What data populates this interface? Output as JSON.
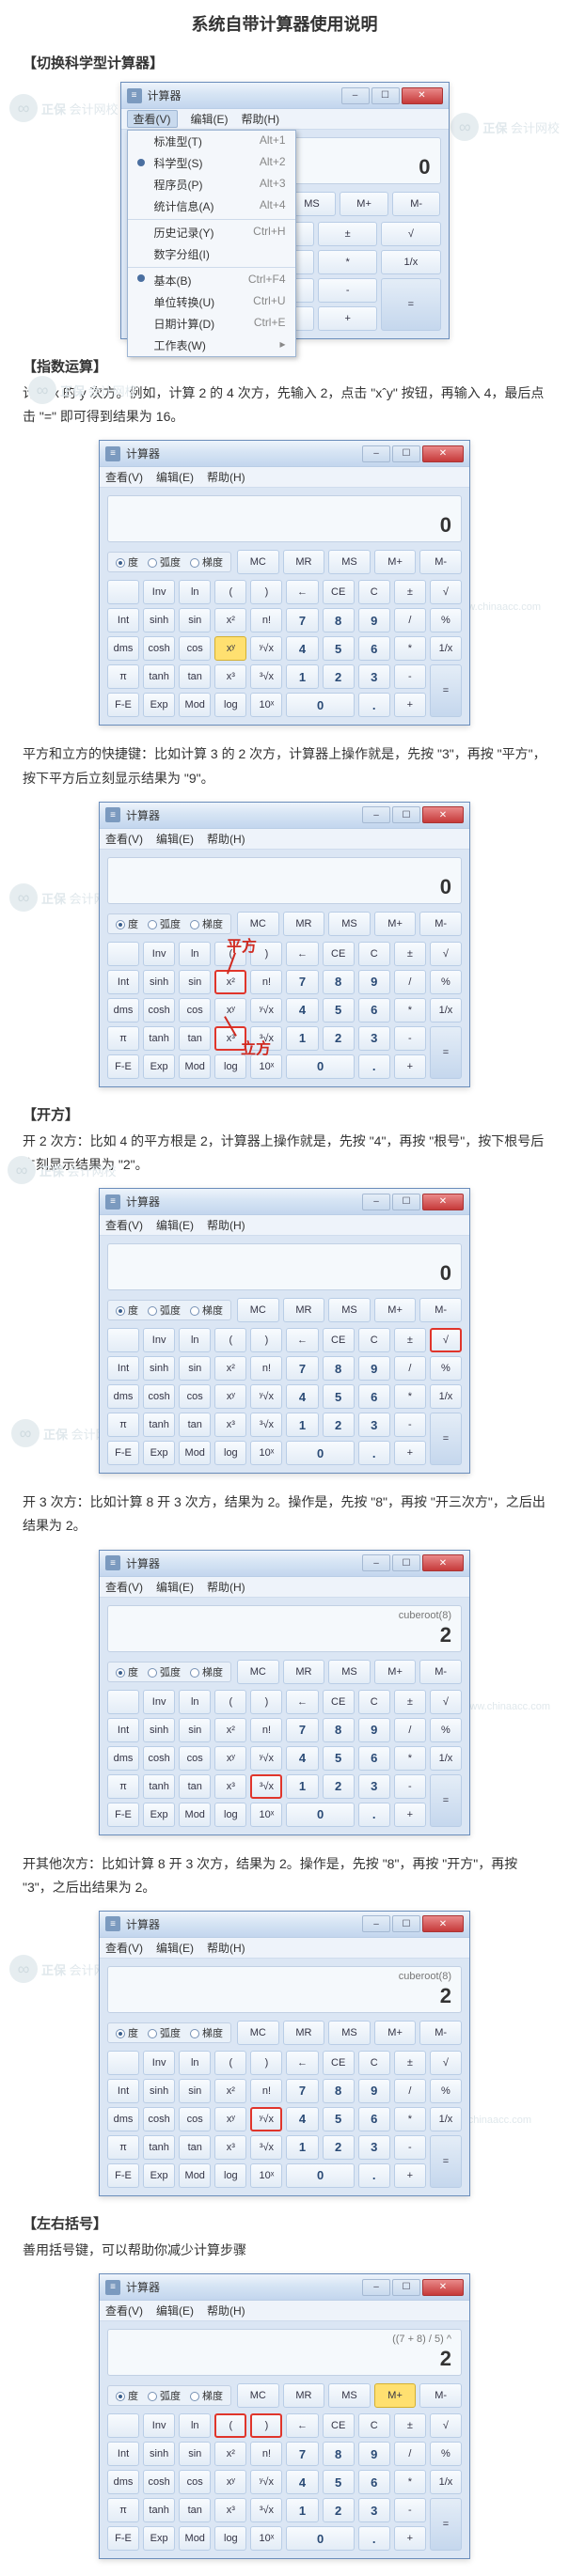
{
  "page_title": "系统自带计算器使用说明",
  "sections": {
    "s1": {
      "head": "【切换科学型计算器】"
    },
    "s2": {
      "head": "【指数运算】",
      "p1": "计算 x 的 y 次方。例如，计算 2 的 4 次方，先输入 2，点击 \"xˆy\" 按钮，再输入 4，最后点击 \"=\" 即可得到结果为 16。",
      "p2": "平方和立方的快捷键：比如计算 3 的 2 次方，计算器上操作就是，先按 \"3\"，再按 \"平方\"，按下平方后立刻显示结果为 \"9\"。"
    },
    "s3": {
      "head": "【开方】",
      "p1": "开 2 次方：比如 4 的平方根是 2，计算器上操作就是，先按 \"4\"，再按 \"根号\"，按下根号后立刻显示结果为 \"2\"。",
      "p2": "开 3 次方：比如计算 8 开 3 次方，结果为 2。操作是，先按 \"8\"，再按 \"开三次方\"，之后出结果为 2。",
      "p3": "开其他次方：比如计算 8 开 3 次方，结果为 2。操作是，先按 \"8\"，再按 \"开方\"，再按 \"3\"，之后出结果为 2。"
    },
    "s4": {
      "head": "【左右括号】",
      "p1": "善用括号键，可以帮助你减少计算步骤"
    }
  },
  "calc": {
    "title": "计算器",
    "menu": {
      "view": "查看(V)",
      "edit": "编辑(E)",
      "help": "帮助(H)"
    },
    "winbtn": {
      "min": "–",
      "max": "☐",
      "close": "✕"
    },
    "angles": {
      "deg": "度",
      "rad": "弧度",
      "grad": "梯度"
    },
    "mem": [
      "MC",
      "MR",
      "MS",
      "M+",
      "M-"
    ],
    "rows": {
      "r1": [
        "",
        "Inv",
        "ln",
        "(",
        ")",
        "←",
        "CE",
        "C",
        "±",
        "√"
      ],
      "r2": [
        "Int",
        "sinh",
        "sin",
        "x²",
        "n!",
        "7",
        "8",
        "9",
        "/",
        "%"
      ],
      "r3": [
        "dms",
        "cosh",
        "cos",
        "xʸ",
        "ʸ√x",
        "4",
        "5",
        "6",
        "*",
        "1/x"
      ],
      "r4": [
        "π",
        "tanh",
        "tan",
        "x³",
        "³√x",
        "1",
        "2",
        "3",
        "-",
        "="
      ],
      "r5": [
        "F-E",
        "Exp",
        "Mod",
        "log",
        "10ˣ",
        "0",
        ".",
        "+"
      ]
    },
    "blank_btn": " ",
    "mplus_y": "M+"
  },
  "dropdown": {
    "items": [
      {
        "label": "标准型(T)",
        "sc": "Alt+1"
      },
      {
        "label": "科学型(S)",
        "sc": "Alt+2",
        "sel": true
      },
      {
        "label": "程序员(P)",
        "sc": "Alt+3"
      },
      {
        "label": "统计信息(A)",
        "sc": "Alt+4"
      },
      {
        "label": "历史记录(Y)",
        "sc": "Ctrl+H",
        "sep": true
      },
      {
        "label": "数字分组(I)"
      },
      {
        "label": "基本(B)",
        "sc": "Ctrl+F4",
        "sep": true,
        "sel": true
      },
      {
        "label": "单位转换(U)",
        "sc": "Ctrl+U"
      },
      {
        "label": "日期计算(D)",
        "sc": "Ctrl+E"
      },
      {
        "label": "工作表(W)",
        "arrow": "▸"
      }
    ]
  },
  "displays": {
    "d0": "0",
    "d2_sub": "cuberoot(8)",
    "d2_main": "2",
    "d_par_sub": "((7 + 8) / 5) ^",
    "d_par_main": "2"
  },
  "anno": {
    "sq": "平方",
    "cube": "立方"
  },
  "watermark": {
    "brand": "正保",
    "text": "会计网校",
    "url": "www.chinaacc.com",
    "logo": "∞"
  }
}
